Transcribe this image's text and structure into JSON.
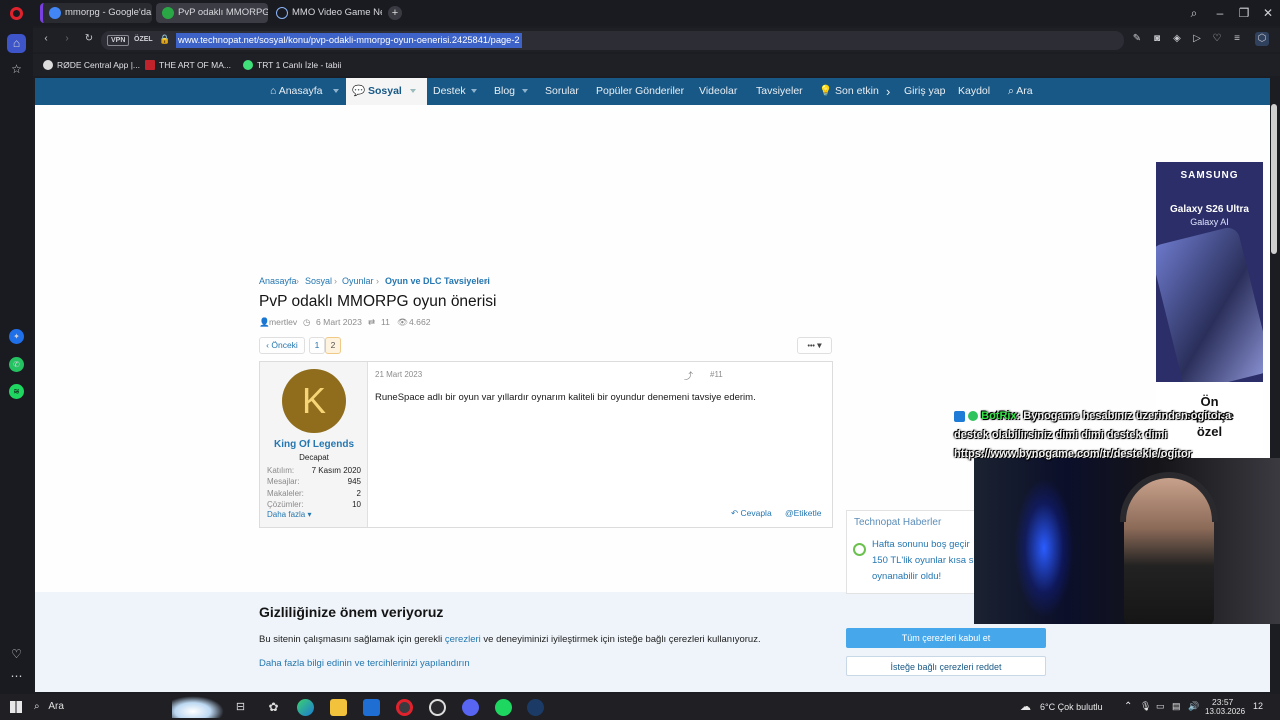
{
  "browser": {
    "tabs": [
      {
        "label": "mmorpg - Google'da Ara",
        "active": false
      },
      {
        "label": "PvP odaklı MMORPG oyun",
        "active": true
      },
      {
        "label": "MMO Video Game News,",
        "active": false
      }
    ],
    "address": {
      "vpn": "VPN",
      "private": "ÖZEL",
      "url": "www.technopat.net/sosyal/konu/pvp-odakli-mmorpg-oyun-oenerisi.2425841/page-2"
    },
    "bookmarks": [
      {
        "label": "RØDE Central App |..."
      },
      {
        "label": "THE ART OF MA..."
      },
      {
        "label": "TRT 1 Canlı İzle - tabii"
      }
    ]
  },
  "site": {
    "nav": {
      "items": [
        "Anasayfa",
        "Sosyal",
        "Destek",
        "Blog",
        "Sorular",
        "Popüler Gönderiler",
        "Videolar",
        "Tavsiyeler",
        "Son etkinl"
      ],
      "login": "Giriş yap",
      "register": "Kaydol",
      "search": "Ara"
    },
    "breadcrumb": [
      "Anasayfa",
      "Sosyal",
      "Oyunlar",
      "Oyun ve DLC Tavsiyeleri"
    ],
    "thread": {
      "title": "PvP odaklı MMORPG oyun önerisi",
      "author": "mertlev",
      "date": "6 Mart 2023",
      "replies": "11",
      "views": "4.662"
    },
    "pagination": {
      "prev": "Önceki",
      "pages": [
        "1",
        "2"
      ],
      "current": "2"
    },
    "menu_label": "•••",
    "post": {
      "date": "21 Mart 2023",
      "number": "#11",
      "body": "RuneSpace adlı bir oyun var yıllardır oynarım kaliteli bir oyundur denemeni tavsiye ederim.",
      "reply": "Cevapla",
      "tag": "Etiketle",
      "user": {
        "avatar_letter": "K",
        "name": "King Of Legends",
        "title": "Decapat",
        "stats": [
          {
            "label": "Katılım:",
            "value": "7 Kasım 2020"
          },
          {
            "label": "Mesajlar:",
            "value": "945"
          },
          {
            "label": "Makaleler:",
            "value": "2"
          },
          {
            "label": "Çözümler:",
            "value": "10"
          }
        ],
        "more": "Daha fazla"
      }
    },
    "news": {
      "heading": "Technopat Haberler",
      "text1": "Hafta sonunu boş geçir",
      "text2": "150 TL'lik oyunlar kısa s",
      "text3": "oynanabilir oldu!"
    },
    "ad": {
      "brand": "SAMSUNG",
      "product": "Galaxy S26 Ultra",
      "sub": "Galaxy AI",
      "promo1": "Ön",
      "promo2": "siparişe",
      "promo3": "özel"
    },
    "cookie": {
      "title": "Gizliliğinize önem veriyoruz",
      "text_before": "Bu sitenin çalışmasını sağlamak için gerekli ",
      "link": "çerezleri",
      "text_after": " ve deneyiminizi iyileştirmek için isteğe bağlı çerezleri kullanıyoruz.",
      "more": "Daha fazla bilgi edinin ve tercihlerinizi yapılandırın",
      "accept": "Tüm çerezleri kabul et",
      "reject": "İsteğe bağlı çerezleri reddet"
    }
  },
  "stream_overlay": {
    "bot": "BotRix",
    "line1": ": Bynogame hesabınız üzerinden ogitor a",
    "line2": "destek olabilirsiniz dimi dimi destek dimi",
    "line3": "https://www.bynogame.com/tr/destekle/ogitor"
  },
  "taskbar": {
    "search": "Ara",
    "weather": "6°C  Çok bulutlu",
    "time": "23:57",
    "date": "13.03.2026",
    "notifications": "12"
  },
  "colors": {
    "nav": "#185886",
    "link": "#2577b1",
    "accept": "#47a7eb",
    "avatar": "#8f6d1c"
  }
}
